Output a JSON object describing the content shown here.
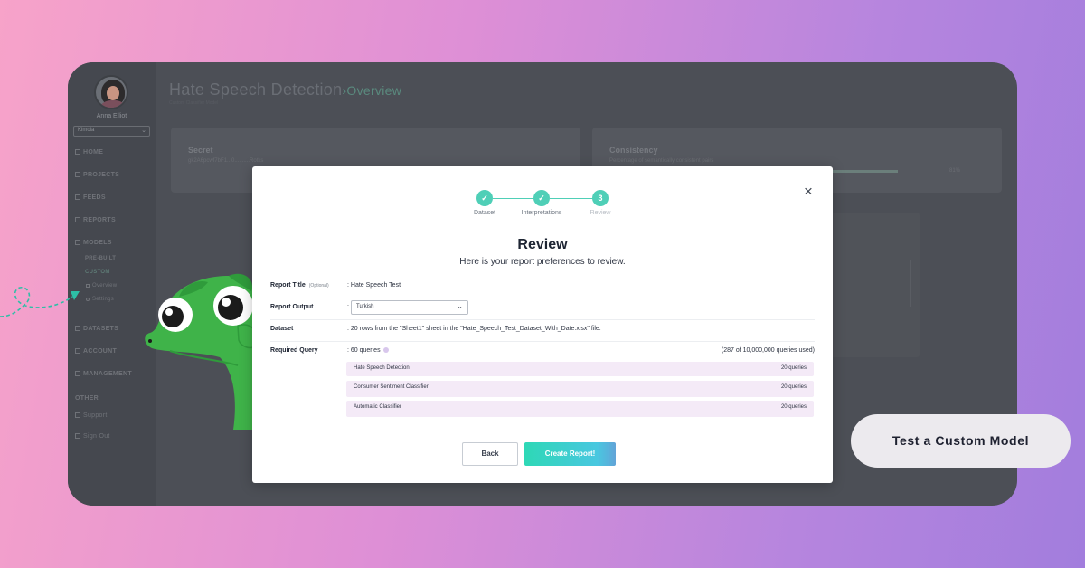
{
  "sidebar": {
    "user_name": "Anna Elliot",
    "org": "Kimola",
    "items": [
      {
        "label": "HOME",
        "icon": "home-icon"
      },
      {
        "label": "PROJECTS",
        "icon": "folder-icon"
      },
      {
        "label": "FEEDS",
        "icon": "feed-icon"
      },
      {
        "label": "REPORTS",
        "icon": "report-icon"
      },
      {
        "label": "MODELS",
        "icon": "model-icon"
      }
    ],
    "sub_items": [
      "PRE-BUILT",
      "CUSTOM"
    ],
    "custom_children": [
      "Overview",
      "Settings"
    ],
    "bottom_items": [
      {
        "label": "DATASETS",
        "icon": "dataset-icon"
      },
      {
        "label": "ACCOUNT",
        "icon": "account-icon"
      },
      {
        "label": "MANAGEMENT",
        "icon": "management-icon"
      }
    ],
    "other_label": "OTHER",
    "other_items": [
      "Support",
      "Sign Out"
    ]
  },
  "background_page": {
    "title": "Hate Speech Detection",
    "title_sep": "›",
    "title_section": "Overview",
    "subtitle": "Custom Classifier Model",
    "secret_card": {
      "title": "Secret",
      "value": "gk2A6pcwf7bF1...0..........Rotks"
    },
    "consistency_card": {
      "title": "Consistency",
      "subtitle": "Percentage of semantically consistent pairs",
      "progress": 0.81,
      "percent_label": "81%"
    }
  },
  "modal": {
    "steps": [
      {
        "label": "Dataset",
        "state": "done",
        "mark": "✓"
      },
      {
        "label": "Interpretations",
        "state": "done",
        "mark": "✓"
      },
      {
        "label": "Review",
        "state": "current",
        "mark": "3"
      }
    ],
    "title": "Review",
    "subtitle": "Here is your report preferences to review.",
    "fields": {
      "report_title_label": "Report Title",
      "report_title_optional": "(Optional)",
      "report_title_value": ": Hate Speech Test",
      "report_output_label": "Report Output",
      "report_output_colon": ":",
      "report_output_value": "Turkish",
      "dataset_label": "Dataset",
      "dataset_value": ": 20 rows from the \"Sheet1\" sheet in the \"Hate_Speech_Test_Dataset_With_Date.xlsx\" file.",
      "required_query_label": "Required Query",
      "required_query_value": ": 60 queries",
      "queries_used": "(287 of 10,000,000 queries used)"
    },
    "query_rows": [
      {
        "name": "Hate Speech Detection",
        "count": "20 queries"
      },
      {
        "name": "Consumer Sentiment Classifier",
        "count": "20 queries"
      },
      {
        "name": "Automatic Classifier",
        "count": "20 queries"
      }
    ],
    "back_label": "Back",
    "create_label": "Create Report!"
  },
  "cta_label": "Test a Custom Model",
  "colors": {
    "accent": "#4fcfb7",
    "query_row_bg": "#f4eaf7",
    "overlay": "#4c4f56"
  }
}
